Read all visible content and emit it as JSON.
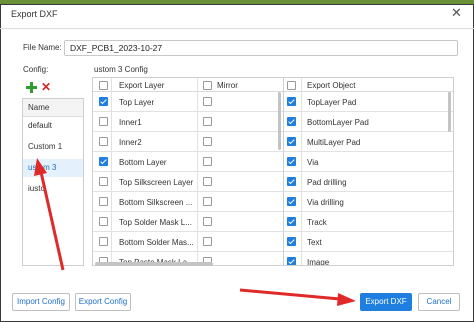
{
  "window": {
    "title": "Export DXF",
    "close_glyph": "✕"
  },
  "file_name": {
    "label": "File Name:",
    "value": "DXF_PCB1_2023-10-27"
  },
  "config": {
    "label": "Config:",
    "list_header": "Name",
    "items": [
      "default",
      "Custom 1",
      "ustom 3",
      "iusto"
    ],
    "selected_index": 2
  },
  "panel_title": "ustom 3 Config",
  "layers": {
    "col_layer": "Export Layer",
    "col_mirror": "Mirror",
    "rows": [
      {
        "name": "Top Layer",
        "checked": true
      },
      {
        "name": "Inner1",
        "checked": false
      },
      {
        "name": "Inner2",
        "checked": false
      },
      {
        "name": "Bottom Layer",
        "checked": true
      },
      {
        "name": "Top Silkscreen Layer",
        "checked": false
      },
      {
        "name": "Bottom Silkscreen ...",
        "checked": false
      },
      {
        "name": "Top Solder Mask L...",
        "checked": false
      },
      {
        "name": "Bottom Solder Mas...",
        "checked": false
      },
      {
        "name": "Top Paste Mask La...",
        "checked": false
      }
    ]
  },
  "objects": {
    "col_object": "Export Object",
    "rows": [
      {
        "name": "TopLayer Pad",
        "checked": true
      },
      {
        "name": "BottomLayer Pad",
        "checked": true
      },
      {
        "name": "MultiLayer Pad",
        "checked": true
      },
      {
        "name": "Via",
        "checked": true
      },
      {
        "name": "Pad drilling",
        "checked": true
      },
      {
        "name": "Via drilling",
        "checked": true
      },
      {
        "name": "Track",
        "checked": true
      },
      {
        "name": "Text",
        "checked": true
      },
      {
        "name": "Image",
        "checked": true
      }
    ]
  },
  "buttons": {
    "import": "Import Config",
    "export_config": "Export Config",
    "export_dxf": "Export DXF",
    "cancel": "Cancel"
  },
  "colors": {
    "accent": "#1e7fe0",
    "annotation_arrow": "#e02a2a",
    "add_icon": "#2f9e2f",
    "delete_icon": "#d9262a"
  }
}
